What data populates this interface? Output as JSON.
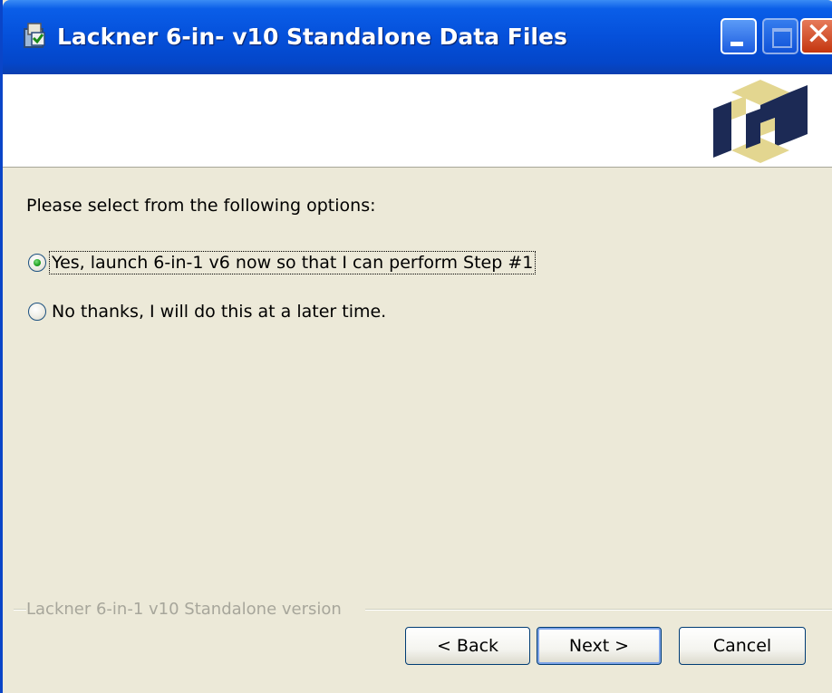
{
  "window": {
    "title": "Lackner 6-in- v10 Standalone Data Files",
    "controls": [
      "minimize",
      "maximize",
      "close"
    ]
  },
  "prompt": "Please select from the following options:",
  "options": [
    {
      "label": "Yes, launch 6-in-1 v6 now so that I can perform Step #1",
      "selected": true
    },
    {
      "label": "No thanks, I will do this at a later time.",
      "selected": false
    }
  ],
  "group_label": "Lackner 6-in-1 v10 Standalone version",
  "buttons": {
    "back": "< Back",
    "next": "Next >",
    "cancel": "Cancel"
  },
  "colors": {
    "titlebar": "#0550da",
    "dialog_bg": "#ece9d8",
    "logo_navy": "#1c2a55",
    "logo_gold": "#e3d690"
  },
  "icons": {
    "title": "installer-icon",
    "banner": "logo-icon"
  }
}
